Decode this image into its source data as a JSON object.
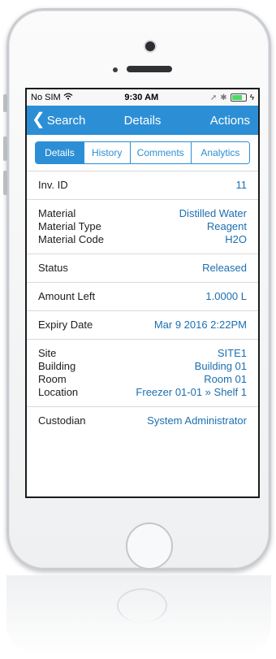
{
  "status_bar": {
    "carrier": "No SIM",
    "time": "9:30 AM"
  },
  "nav": {
    "back_label": "Search",
    "title": "Details",
    "actions_label": "Actions"
  },
  "tabs": [
    {
      "label": "Details",
      "active": true
    },
    {
      "label": "History",
      "active": false
    },
    {
      "label": "Comments",
      "active": false
    },
    {
      "label": "Analytics",
      "active": false
    }
  ],
  "details": {
    "inv_id": {
      "label": "Inv. ID",
      "value": "11"
    },
    "material": {
      "label": "Material",
      "value": "Distilled Water"
    },
    "material_type": {
      "label": "Material Type",
      "value": "Reagent"
    },
    "material_code": {
      "label": "Material Code",
      "value": "H2O"
    },
    "status": {
      "label": "Status",
      "value": "Released"
    },
    "amount_left": {
      "label": "Amount Left",
      "value": "1.0000 L"
    },
    "expiry_date": {
      "label": "Expiry Date",
      "value": "Mar 9 2016 2:22PM"
    },
    "site": {
      "label": "Site",
      "value": "SITE1"
    },
    "building": {
      "label": "Building",
      "value": "Building 01"
    },
    "room": {
      "label": "Room",
      "value": "Room 01"
    },
    "location": {
      "label": "Location",
      "value": "Freezer 01-01 » Shelf 1"
    },
    "custodian": {
      "label": "Custodian",
      "value": "System Administrator"
    }
  },
  "colors": {
    "accent": "#2c8fd6",
    "value_text": "#1c6fb0"
  },
  "icons": [
    "wifi-icon",
    "location-arrow-icon",
    "bluetooth-icon",
    "battery-icon",
    "charging-bolt-icon",
    "back-chevron-icon"
  ]
}
